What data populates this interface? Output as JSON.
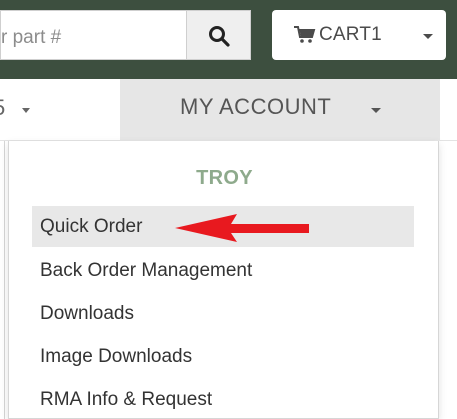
{
  "search": {
    "input_text": "r part #"
  },
  "header": {
    "cart_label": "CART1"
  },
  "nav": {
    "left_fragment": "5",
    "account_label": "MY ACCOUNT"
  },
  "dropdown": {
    "user_name": "TROY",
    "items": [
      {
        "label": "Quick Order",
        "highlighted": true
      },
      {
        "label": "Back Order Management",
        "highlighted": false
      },
      {
        "label": "Downloads",
        "highlighted": false
      },
      {
        "label": "Image Downloads",
        "highlighted": false
      },
      {
        "label": "RMA Info & Request",
        "highlighted": false
      }
    ]
  },
  "icons": {
    "search": "search-icon",
    "cart": "shopping-cart-icon",
    "caret": "caret-down-icon",
    "annotation": "red-arrow-icon"
  },
  "colors": {
    "header_bg": "#3d4f3f",
    "user_name": "#8eaa8c",
    "active_item_bg": "#e8e8e8",
    "account_tab_bg": "#e6e6e6",
    "annotation_arrow": "#e8191f"
  }
}
